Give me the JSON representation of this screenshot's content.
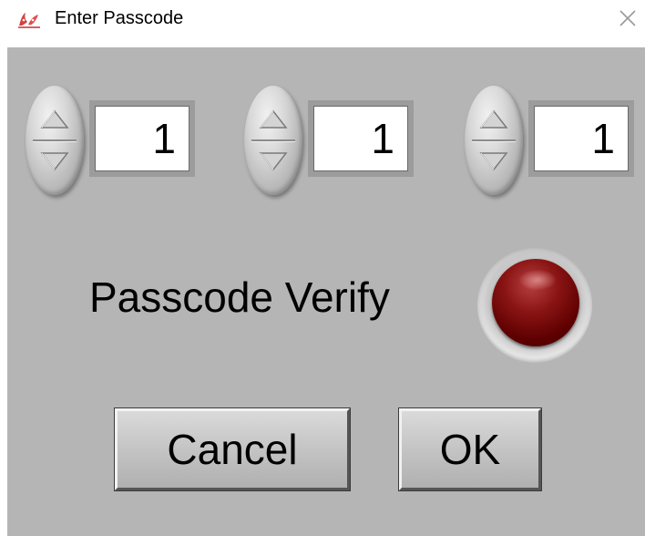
{
  "window": {
    "title": "Enter Passcode",
    "icon": "labview-app-icon",
    "close_icon": "close-icon"
  },
  "panel": {
    "background": "#b5b5b5",
    "digits": [
      {
        "value": "1",
        "up_icon": "increment-arrow-icon",
        "down_icon": "decrement-arrow-icon"
      },
      {
        "value": "1",
        "up_icon": "increment-arrow-icon",
        "down_icon": "decrement-arrow-icon"
      },
      {
        "value": "1",
        "up_icon": "increment-arrow-icon",
        "down_icon": "decrement-arrow-icon"
      }
    ],
    "verify": {
      "label": "Passcode Verify",
      "led_state": "off",
      "led_color": "#7a0a0a"
    },
    "buttons": {
      "cancel_label": "Cancel",
      "ok_label": "OK"
    }
  }
}
